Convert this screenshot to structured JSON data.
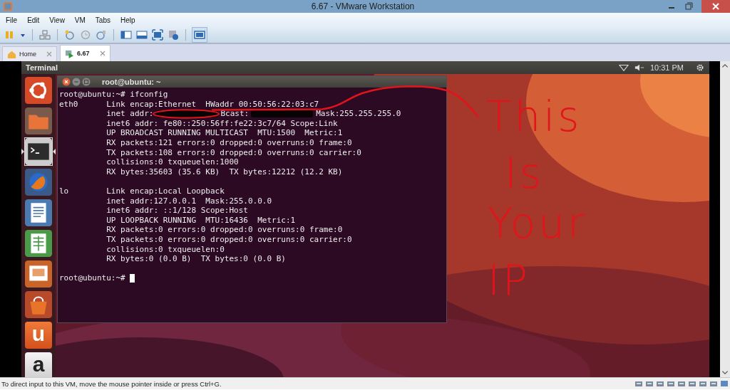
{
  "window": {
    "title": "6.67 - VMware Workstation"
  },
  "menu": [
    "File",
    "Edit",
    "View",
    "VM",
    "Tabs",
    "Help"
  ],
  "tabs": [
    {
      "label": "Home",
      "kind": "home",
      "selected": false
    },
    {
      "label": "6.67",
      "kind": "vm",
      "selected": true
    }
  ],
  "guest": {
    "panel": {
      "app_title": "Terminal",
      "clock": "10:31 PM"
    },
    "launcher": [
      {
        "kind": "ubuntu",
        "selected": false
      },
      {
        "kind": "folder",
        "selected": false
      },
      {
        "kind": "terminal",
        "selected": true
      },
      {
        "kind": "browser",
        "selected": false
      },
      {
        "kind": "writer",
        "selected": false
      },
      {
        "kind": "calc",
        "selected": false
      },
      {
        "kind": "impress",
        "selected": false
      },
      {
        "kind": "store",
        "selected": false
      },
      {
        "kind": "letter",
        "glyph": "u",
        "selected": false
      },
      {
        "kind": "letter",
        "glyph": "a",
        "selected": false
      }
    ],
    "terminal": {
      "title": "root@ubuntu: ~",
      "prompt_command": "root@ubuntu:~# ifconfig",
      "interfaces": [
        {
          "name": "eth0",
          "lines": [
            {
              "text": "Link encap:Ethernet  HWaddr 00:50:56:22:03:c7"
            },
            {
              "parts": [
                {
                  "kind": "text",
                  "text": "inet addr:"
                },
                {
                  "kind": "redacted"
                },
                {
                  "kind": "text",
                  "text": "Bcast:"
                },
                {
                  "kind": "redacted"
                },
                {
                  "kind": "text",
                  "text": "Mask:255.255.255.0"
                }
              ]
            },
            {
              "text": "inet6 addr: fe80::250:56ff:fe22:3c7/64 Scope:Link"
            },
            {
              "text": "UP BROADCAST RUNNING MULTICAST  MTU:1500  Metric:1"
            },
            {
              "text": "RX packets:121 errors:0 dropped:0 overruns:0 frame:0"
            },
            {
              "text": "TX packets:108 errors:0 dropped:0 overruns:0 carrier:0"
            },
            {
              "text": "collisions:0 txqueuelen:1000"
            },
            {
              "text": "RX bytes:35603 (35.6 KB)  TX bytes:12212 (12.2 KB)"
            }
          ]
        },
        {
          "name": "lo",
          "lines": [
            {
              "text": "Link encap:Local Loopback"
            },
            {
              "text": "inet addr:127.0.0.1  Mask:255.0.0.0"
            },
            {
              "text": "inet6 addr: ::1/128 Scope:Host"
            },
            {
              "text": "UP LOOPBACK RUNNING  MTU:16436  Metric:1"
            },
            {
              "text": "RX packets:0 errors:0 dropped:0 overruns:0 frame:0"
            },
            {
              "text": "TX packets:0 errors:0 dropped:0 overruns:0 carrier:0"
            },
            {
              "text": "collisions:0 txqueuelen:0"
            },
            {
              "text": "RX bytes:0 (0.0 B)  TX bytes:0 (0.0 B)"
            }
          ]
        }
      ],
      "prompt": "root@ubuntu:~#"
    }
  },
  "annotation": {
    "lines": [
      "This",
      "Is",
      "Your",
      "IP"
    ]
  },
  "status_bar": {
    "text": "To direct input to this VM, move the mouse pointer inside or press Ctrl+G."
  }
}
